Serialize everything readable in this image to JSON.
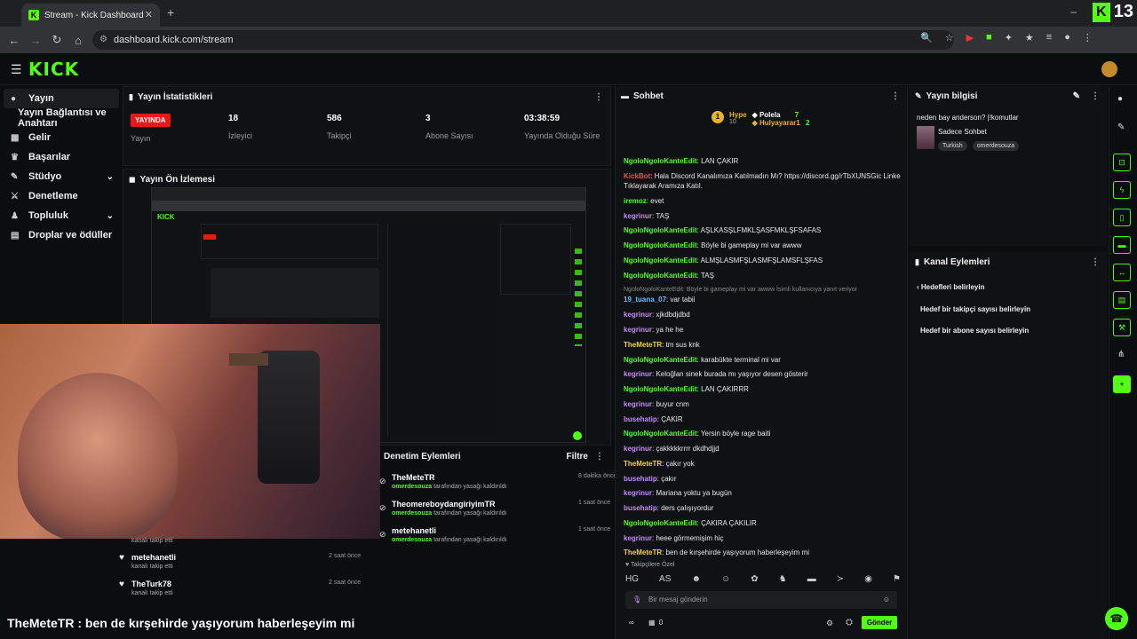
{
  "browser": {
    "tab_title": "Stream - Kick Dashboard",
    "url": "dashboard.kick.com/stream",
    "badge_count": "13"
  },
  "header": {
    "logo": "KICK"
  },
  "sidebar": {
    "items": [
      {
        "label": "Yayın"
      },
      {
        "label": "Yayın Bağlantısı ve Anahtarı"
      },
      {
        "label": "Gelir"
      },
      {
        "label": "Başarılar"
      },
      {
        "label": "Stüdyo"
      },
      {
        "label": "Denetleme"
      },
      {
        "label": "Topluluk"
      },
      {
        "label": "Droplar ve ödüller"
      }
    ]
  },
  "stats": {
    "title": "Yayın İstatistikleri",
    "live_badge": "YAYINDA",
    "items": [
      {
        "value": "",
        "label": "Yayın"
      },
      {
        "value": "18",
        "label": "İzleyici"
      },
      {
        "value": "586",
        "label": "Takipçi"
      },
      {
        "value": "3",
        "label": "Abone Sayısı"
      },
      {
        "value": "03:38:59",
        "label": "Yayında Olduğu Süre"
      }
    ]
  },
  "preview": {
    "title": "Yayın Ön İzlemesi"
  },
  "followers": [
    {
      "name": "",
      "desc": "kanalı takip etti",
      "time": ""
    },
    {
      "name": "metehanetli",
      "desc": "kanalı takip etti",
      "time": "2 saat önce"
    },
    {
      "name": "TheTurk78",
      "desc": "kanalı takip etti",
      "time": "2 saat önce"
    }
  ],
  "moderation": {
    "title": "Denetim Eylemleri",
    "filter": "Filtre",
    "items": [
      {
        "name": "TheMeteTR",
        "by": "omerdesouza",
        "action": "tarafından yasağı kaldırıldı",
        "time": "8 dakika önce"
      },
      {
        "name": "TheomereboydangiriyimTR",
        "by": "omerdesouza",
        "action": "tarafından yasağı kaldırıldı",
        "time": "1 saat önce"
      },
      {
        "name": "metehanetli",
        "by": "omerdesouza",
        "action": "tarafından yasağı kaldırıldı",
        "time": "1 saat önce"
      }
    ]
  },
  "chat": {
    "title": "Sohbet",
    "hype": {
      "label": "Hype",
      "level": "1",
      "count": "10"
    },
    "leaders": [
      {
        "name": "Polela",
        "count": "7"
      },
      {
        "name": "Hulyayarar1",
        "count": "2"
      }
    ],
    "messages": [
      {
        "user": "NgoloNgoloKanteEdit",
        "text": ": LAN ÇAKIR",
        "color": "green"
      },
      {
        "user": "KickBot",
        "text": ": Hala Discord Kanalımıza Katılmadın Mı? https://discord.gg/rTbXUNSGic Linke Tıklayarak Aramıza Katıl.",
        "color": "red"
      },
      {
        "user": "iremoz",
        "text": ": evet",
        "color": "green"
      },
      {
        "user": "kegrinur",
        "text": ": TAŞ",
        "color": "purple"
      },
      {
        "user": "NgoloNgoloKanteEdit",
        "text": ": AŞLKASŞLFMKLŞASFMKLŞFSAFAS",
        "color": "green"
      },
      {
        "user": "NgoloNgoloKanteEdit",
        "text": ": Böyle bi gameplay mi var awww",
        "color": "green"
      },
      {
        "user": "NgoloNgoloKanteEdit",
        "text": ": ALMŞLASMFŞLASMFŞLAMSFLŞFAS",
        "color": "green"
      },
      {
        "user": "NgoloNgoloKanteEdit",
        "text": ": TAŞ",
        "color": "green"
      },
      {
        "user": "19_tuana_07",
        "text": ": var tabii",
        "color": "blue",
        "reply": "NgoloNgoloKanteEdit: Böyle bi gameplay mi var awww İsimli kullanıcıya yanıt veriyor"
      },
      {
        "user": "kegrinur",
        "text": ": xjkdbdjdbd",
        "color": "purple"
      },
      {
        "user": "kegrinur",
        "text": ": ya he he",
        "color": "purple"
      },
      {
        "user": "TheMeteTR",
        "text": ": tm sus knk",
        "color": "yellow"
      },
      {
        "user": "NgoloNgoloKanteEdit",
        "text": ": karabükte terminal mi var",
        "color": "green"
      },
      {
        "user": "kegrinur",
        "text": ": Keloğlan sinek burada mı yaşıyor desen gösterir",
        "color": "purple"
      },
      {
        "user": "NgoloNgoloKanteEdit",
        "text": ": LAN ÇAKIRRR",
        "color": "green"
      },
      {
        "user": "kegrinur",
        "text": ": buyur cnm",
        "color": "purple"
      },
      {
        "user": "busehatip",
        "text": ": ÇAKIR",
        "color": "purple"
      },
      {
        "user": "NgoloNgoloKanteEdit",
        "text": ": Yersin böyle rage baiti",
        "color": "green"
      },
      {
        "user": "kegrinur",
        "text": ": çakkkkkrrrr dkdhdjjd",
        "color": "purple"
      },
      {
        "user": "TheMeteTR",
        "text": ": çakır yok",
        "color": "yellow"
      },
      {
        "user": "busehatip",
        "text": ": çakır",
        "color": "purple"
      },
      {
        "user": "kegrinur",
        "text": ": Mariana yoktu ya bugün",
        "color": "purple"
      },
      {
        "user": "busehatip",
        "text": ": ders çalışıyordur",
        "color": "purple"
      },
      {
        "user": "NgoloNgoloKanteEdit",
        "text": ": ÇAKIRA ÇAKILIR",
        "color": "green"
      },
      {
        "user": "kegrinur",
        "text": ": heee görmemişim hiç",
        "color": "purple"
      },
      {
        "user": "TheMeteTR",
        "text": ": ben de kırşehirde yaşıyorum haberleşeyim mi",
        "color": "yellow"
      }
    ],
    "followers_only": "Takipçilere Özel",
    "input_placeholder": "Bir mesaj gönderin",
    "send": "Gönder",
    "chatters": "0"
  },
  "stream_info": {
    "title": "Yayın bilgisi",
    "stream_title": "neden bay anderson? |!komutlar",
    "category": "Sadece Sohbet",
    "tags": [
      "Turkish",
      "omerdesouza"
    ]
  },
  "channel_actions": {
    "title": "Kanal Eylemleri",
    "back_label": "Hedefleri belirleyin",
    "items": [
      "Hedef bir takipçi sayısı belirleyin",
      "Hedef bir abone sayısı belirleyin"
    ]
  },
  "overlay_caption": "TheMeteTR : ben de kırşehirde yaşıyorum haberleşeyim mi",
  "colors": {
    "accent": "#53fc18",
    "live": "#e91916",
    "background": "#0b0e0f"
  }
}
